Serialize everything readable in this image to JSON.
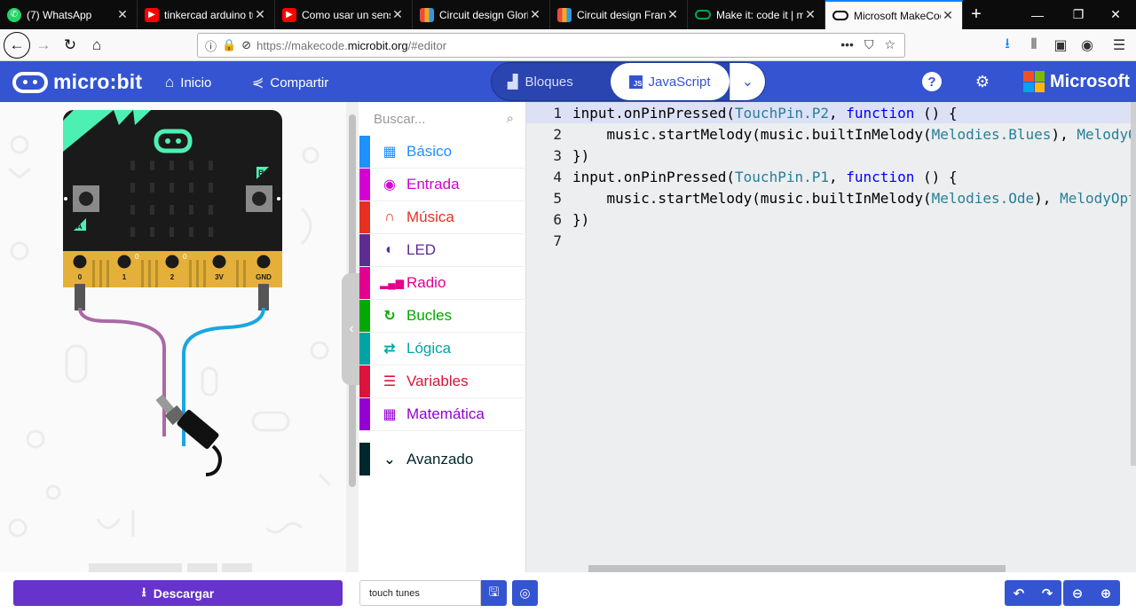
{
  "browser": {
    "tabs": [
      {
        "label": "(7) WhatsApp",
        "favicon_color": "#25d366",
        "favicon_glyph": "whatsapp-icon"
      },
      {
        "label": "tinkercad arduino tu",
        "favicon_color": "#ff0000",
        "favicon_glyph": "youtube-icon"
      },
      {
        "label": "Como usar un sensor",
        "favicon_color": "#ff0000",
        "favicon_glyph": "youtube-icon"
      },
      {
        "label": "Circuit design Glorio",
        "favicon_color": "#f5a623",
        "favicon_glyph": "tinkercad-icon"
      },
      {
        "label": "Circuit design Frantic",
        "favicon_color": "#f5a623",
        "favicon_glyph": "tinkercad-icon"
      },
      {
        "label": "Make it: code it | mi",
        "favicon_color": "#00a651",
        "favicon_glyph": "microbit-icon"
      },
      {
        "label": "Microsoft MakeCode",
        "favicon_color": "#0c0c0d",
        "favicon_glyph": "microbit-icon"
      }
    ],
    "url_prefix": "https://makecode.",
    "url_host": "microbit.org",
    "url_suffix": "/#editor",
    "window_controls": {
      "minimize": "—",
      "restore": "❐",
      "close": "✕"
    }
  },
  "header": {
    "brand": "micro:bit",
    "home_label": "Inicio",
    "share_label": "Compartir",
    "blocks_label": "Bloques",
    "js_label": "JavaScript",
    "js_badge": "JS",
    "ms_label": "Microsoft",
    "accent": "#3454d1"
  },
  "simulator": {
    "pin_labels": [
      "0",
      "1",
      "2",
      "3V",
      "GND"
    ],
    "button_a": "A",
    "button_b": "B",
    "wire_colors": [
      "#a96aa5",
      "#1aa6e0"
    ]
  },
  "toolbox": {
    "search_placeholder": "Buscar...",
    "categories": [
      {
        "label": "Básico",
        "color": "#1e90ff",
        "icon": "grid-icon",
        "glyph": "▦"
      },
      {
        "label": "Entrada",
        "color": "#d400d4",
        "icon": "target-icon",
        "glyph": "◉"
      },
      {
        "label": "Música",
        "color": "#e63022",
        "icon": "headphones-icon",
        "glyph": "🎧"
      },
      {
        "label": "LED",
        "color": "#5c2d91",
        "icon": "toggle-icon",
        "glyph": "◐"
      },
      {
        "label": "Radio",
        "color": "#e3008c",
        "icon": "signal-icon",
        "glyph": "▂▄▆"
      },
      {
        "label": "Bucles",
        "color": "#00aa00",
        "icon": "refresh-icon",
        "glyph": "↻"
      },
      {
        "label": "Lógica",
        "color": "#00a4a6",
        "icon": "shuffle-icon",
        "glyph": "⇄"
      },
      {
        "label": "Variables",
        "color": "#dc143c",
        "icon": "list-icon",
        "glyph": "☰"
      },
      {
        "label": "Matemática",
        "color": "#9400d3",
        "icon": "calculator-icon",
        "glyph": "▦"
      },
      {
        "label": "Avanzado",
        "color": "#00272b",
        "icon": "chevron-down-icon",
        "glyph": "⌄"
      }
    ]
  },
  "editor": {
    "line_numbers": [
      "1",
      "2",
      "3",
      "4",
      "5",
      "6",
      "7"
    ]
  },
  "bottom": {
    "download_label": "Descargar",
    "project_name": "touch tunes"
  }
}
